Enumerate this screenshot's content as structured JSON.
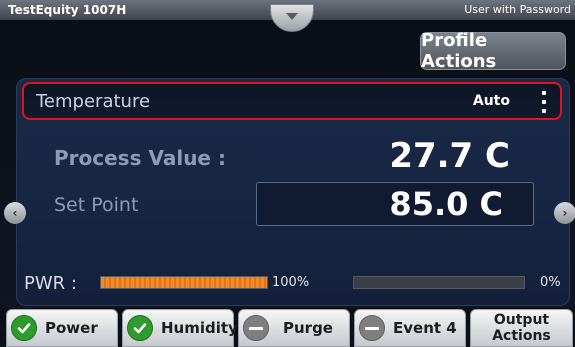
{
  "titlebar": {
    "device": "TestEquity 1007H",
    "user": "User with Password"
  },
  "profile_actions_label": "Profile Actions",
  "temperature": {
    "label": "Temperature",
    "mode": "Auto"
  },
  "process_value": {
    "label": "Process Value :",
    "value": "27.7 C"
  },
  "set_point": {
    "label": "Set Point",
    "value": "85.0 C"
  },
  "power": {
    "label": "PWR :",
    "bar1_percent_text": "100%",
    "bar1_fraction": 1.0,
    "bar2_percent_text": "0%",
    "bar2_fraction": 0.0
  },
  "tabs": [
    {
      "label": "Power",
      "icon": "check-icon",
      "status_color": "#2f9a2e"
    },
    {
      "label": "Humidity",
      "icon": "check-icon",
      "status_color": "#2f9a2e"
    },
    {
      "label": "Purge",
      "icon": "minus-icon",
      "status_color": "#7f7f7f"
    },
    {
      "label": "Event 4",
      "icon": "minus-icon",
      "status_color": "#7f7f7f"
    },
    {
      "label_line1": "Output",
      "label_line2": "Actions"
    }
  ],
  "colors": {
    "highlight_border": "#e0141c",
    "power_bar": "#f08a2a"
  }
}
